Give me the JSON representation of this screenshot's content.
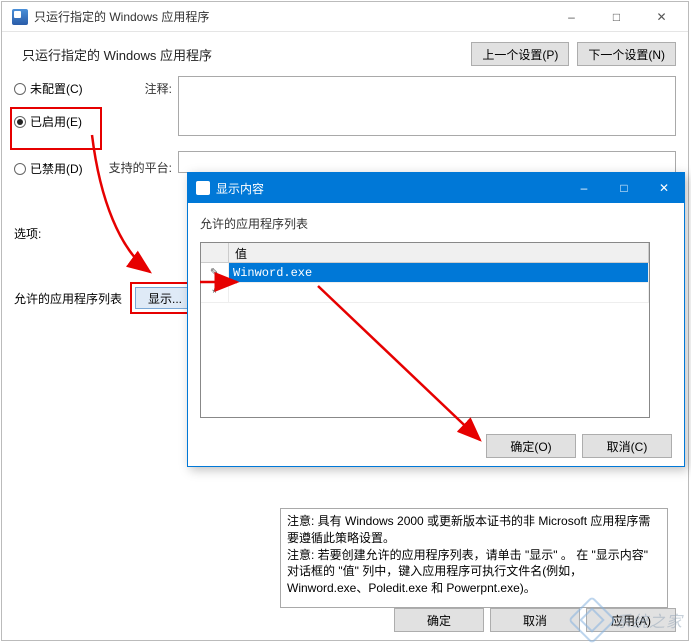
{
  "main_window": {
    "title": "只运行指定的 Windows 应用程序",
    "header_title": "只运行指定的 Windows 应用程序",
    "prev_btn": "上一个设置(P)",
    "next_btn": "下一个设置(N)",
    "radio": {
      "not_configured": "未配置(C)",
      "enabled": "已启用(E)",
      "disabled": "已禁用(D)"
    },
    "labels": {
      "comment": "注释:",
      "platform": "支持的平台:",
      "options": "选项:",
      "allowed_list": "允许的应用程序列表",
      "show_btn": "显示..."
    },
    "notes": [
      "注意: 具有 Windows 2000 或更新版本证书的非 Microsoft 应用程序需要遵循此策略设置。",
      "注意: 若要创建允许的应用程序列表，请单击 \"显示\" 。  在 \"显示内容\" 对话框的 \"值\" 列中，键入应用程序可执行文件名(例如，Winword.exe、Poledit.exe 和 Powerpnt.exe)。"
    ],
    "footer": {
      "ok": "确定",
      "cancel": "取消",
      "apply": "应用(A)"
    }
  },
  "dialog": {
    "title": "显示内容",
    "label": "允许的应用程序列表",
    "column_header": "值",
    "rows": [
      {
        "marker": "pencil",
        "value": "Winword.exe"
      },
      {
        "marker": "*",
        "value": ""
      }
    ],
    "ok": "确定(O)",
    "cancel": "取消(C)"
  },
  "watermark": {
    "text": "系统之家"
  }
}
